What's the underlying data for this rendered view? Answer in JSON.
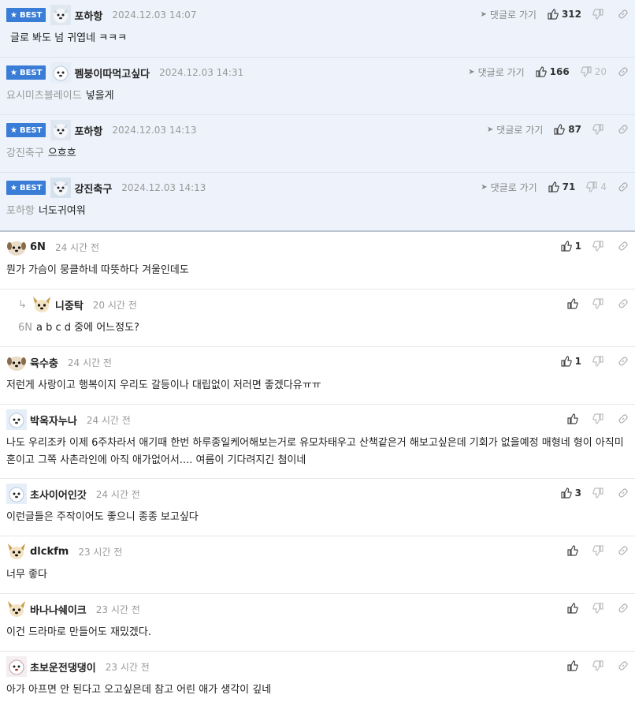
{
  "ui": {
    "best_badge": "BEST",
    "goto_reply": "댓글로 가기"
  },
  "best_comments": [
    {
      "nick": "포하항",
      "time": "2024.12.03 14:07",
      "mention": "",
      "text": "글로 봐도 넘 귀엽네 ㅋㅋㅋ",
      "up": "312",
      "down": ""
    },
    {
      "nick": "펨붕이따먹고싶다",
      "time": "2024.12.03 14:31",
      "mention": "요시미츠블레이드",
      "text": "넣을게",
      "up": "166",
      "down": "20"
    },
    {
      "nick": "포하항",
      "time": "2024.12.03 14:13",
      "mention": "강진축구",
      "text": "으흐흐",
      "up": "87",
      "down": ""
    },
    {
      "nick": "강진축구",
      "time": "2024.12.03 14:13",
      "mention": "포하항",
      "text": "너도귀여워",
      "up": "71",
      "down": "4"
    }
  ],
  "comments": [
    {
      "nick": "6N",
      "time": "24 시간 전",
      "mention": "",
      "text": "뭔가 가슴이 뭉클하네 따뜻하다 겨울인데도",
      "up": "1",
      "reply": false
    },
    {
      "nick": "니중탁",
      "time": "20 시간 전",
      "mention": "6N",
      "text": "a b c d 중에 어느정도?",
      "up": "",
      "reply": true
    },
    {
      "nick": "육수충",
      "time": "24 시간 전",
      "mention": "",
      "text": "저런게 사랑이고 행복이지 우리도 갈등이나 대립없이 저러면 좋겠다유ㅠㅠ",
      "up": "1",
      "reply": false
    },
    {
      "nick": "박옥자누나",
      "time": "24 시간 전",
      "mention": "",
      "text": "나도 우리조카 이제 6주차라서 애기때 한번 하루종일케어해보는거로 유모차태우고 산책같은거 해보고싶은데 기회가 없을예정 매형네 형이 아직미혼이고 그쪽 사촌라인에 아직 애가없어서.... 여름이 기다려지긴 첨이네",
      "up": "",
      "reply": false
    },
    {
      "nick": "초사이어인갓",
      "time": "24 시간 전",
      "mention": "",
      "text": "이런글들은 주작이어도 좋으니 종종 보고싶다",
      "up": "3",
      "reply": false
    },
    {
      "nick": "dlckfm",
      "time": "23 시간 전",
      "mention": "",
      "text": "너무 좋다",
      "up": "",
      "reply": false
    },
    {
      "nick": "바나나쉐이크",
      "time": "23 시간 전",
      "mention": "",
      "text": "이건 드라마로 만들어도 재밌겠다.",
      "up": "",
      "reply": false
    },
    {
      "nick": "초보운전댕댕이",
      "time": "23 시간 전",
      "mention": "",
      "text": "아가 아프면 안 된다고 오고싶은데 참고 어린 애가 생각이 깊네",
      "up": "",
      "reply": false
    }
  ],
  "colors": {
    "badge": "#3a7dd6",
    "best_bg": "#eef3fb",
    "muted": "#999999"
  },
  "icons": {
    "up": "thumbs-up-icon",
    "down": "thumbs-down-icon",
    "link": "link-icon",
    "plane": "send-arrow-icon"
  }
}
